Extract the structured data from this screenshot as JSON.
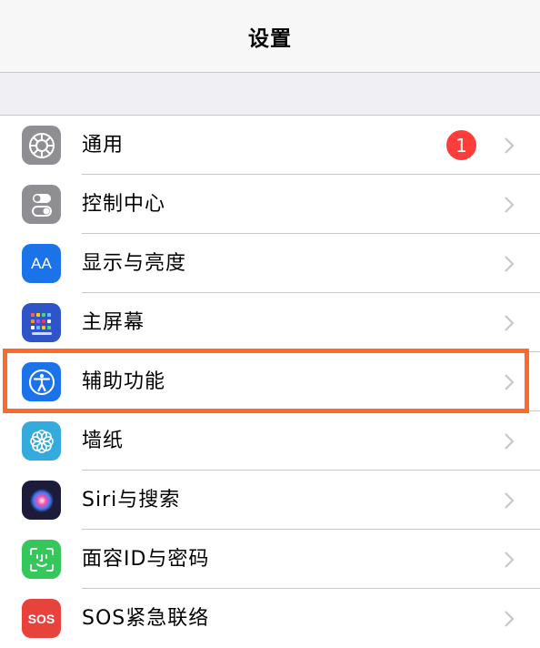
{
  "header": {
    "title": "设置"
  },
  "rows": [
    {
      "label": "通用",
      "icon": "gear-icon",
      "icon_bg": "#8e8e93",
      "badge": "1"
    },
    {
      "label": "控制中心",
      "icon": "toggle-switches-icon",
      "icon_bg": "#8e8e93"
    },
    {
      "label": "显示与亮度",
      "icon": "aa-display-icon",
      "icon_bg": "#1a73e8",
      "icon_text": "AA"
    },
    {
      "label": "主屏幕",
      "icon": "home-screen-grid-icon",
      "icon_bg": "#2f53c9"
    },
    {
      "label": "辅助功能",
      "icon": "accessibility-person-icon",
      "icon_bg": "#1a73e8",
      "highlighted": true
    },
    {
      "label": "墙纸",
      "icon": "flower-icon",
      "icon_bg": "#35aadc"
    },
    {
      "label": "Siri与搜索",
      "icon": "siri-orb-icon",
      "icon_bg": "#1c1c3a"
    },
    {
      "label": "面容ID与密码",
      "icon": "face-id-icon",
      "icon_bg": "#34c759"
    },
    {
      "label": "SOS紧急联络",
      "icon": "sos-icon",
      "icon_bg": "#e8423c",
      "icon_text": "SOS"
    }
  ],
  "colors": {
    "highlight": "#ff6a2c",
    "badge": "#fc3d39",
    "chevron": "#c7c7cc"
  }
}
